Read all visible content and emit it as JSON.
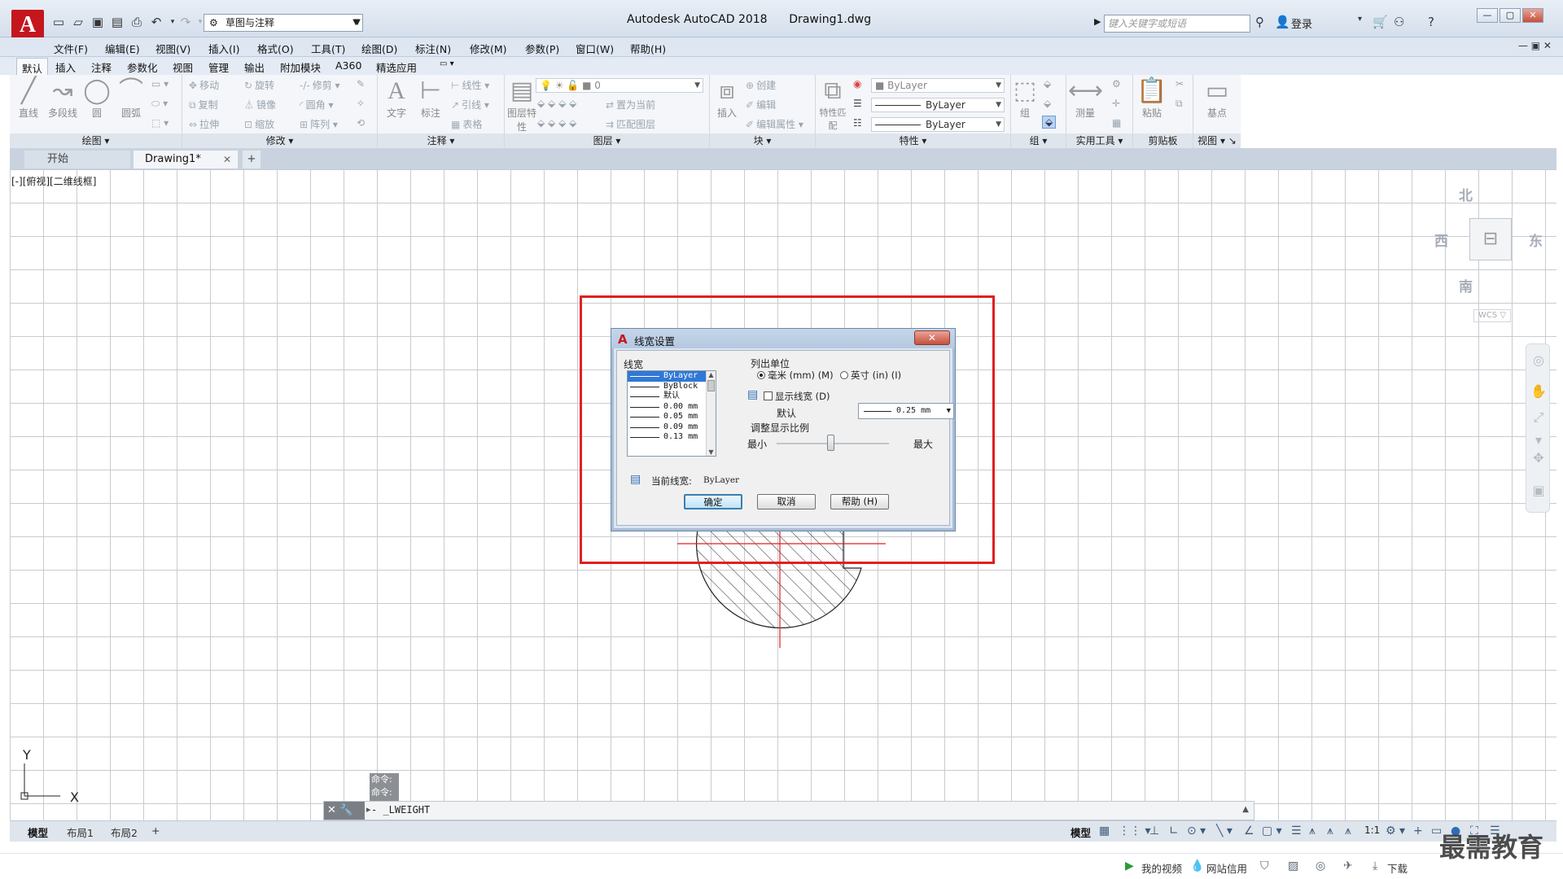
{
  "titlebar": {
    "workspace": "草图与注释",
    "app_name": "Autodesk AutoCAD 2018",
    "document": "Drawing1.dwg",
    "search_placeholder": "键入关键字或短语",
    "login": "登录",
    "app_button": "A"
  },
  "menu": [
    "文件(F)",
    "编辑(E)",
    "视图(V)",
    "插入(I)",
    "格式(O)",
    "工具(T)",
    "绘图(D)",
    "标注(N)",
    "修改(M)",
    "参数(P)",
    "窗口(W)",
    "帮助(H)"
  ],
  "ribbon_tabs": [
    "默认",
    "插入",
    "注释",
    "参数化",
    "视图",
    "管理",
    "输出",
    "附加模块",
    "A360",
    "精选应用"
  ],
  "ribbon": {
    "draw": {
      "title": "绘图",
      "tools": [
        "直线",
        "多段线",
        "圆",
        "圆弧"
      ]
    },
    "modify": {
      "title": "修改",
      "tools": [
        "移动",
        "旋转",
        "修剪",
        "复制",
        "镜像",
        "圆角",
        "拉伸",
        "缩放",
        "阵列"
      ]
    },
    "annotate": {
      "title": "注释",
      "tools": [
        "文字",
        "标注",
        "线性",
        "引线",
        "表格"
      ]
    },
    "layers": {
      "title": "图层",
      "tools": [
        "图层特性",
        "置为当前",
        "匹配图层"
      ],
      "layer_value": "0"
    },
    "block": {
      "title": "块",
      "tools": [
        "插入",
        "创建",
        "编辑",
        "编辑属性"
      ]
    },
    "properties": {
      "title": "特性",
      "tools": [
        "特性匹配"
      ],
      "values": [
        "ByLayer",
        "ByLayer",
        "ByLayer"
      ]
    },
    "groups": {
      "title": "组",
      "tools": [
        "组"
      ]
    },
    "utilities": {
      "title": "实用工具",
      "tools": [
        "测量"
      ]
    },
    "clipboard": {
      "title": "剪贴板",
      "tools": [
        "粘贴"
      ]
    },
    "view": {
      "title": "视图",
      "tools": [
        "基点"
      ]
    }
  },
  "doc_tabs": {
    "start": "开始",
    "drawing": "Drawing1*",
    "add": "+"
  },
  "canvas": {
    "view_label": "[-][俯视][二维线框]",
    "compass": {
      "north": "北",
      "south": "南",
      "west": "西",
      "east": "东"
    },
    "wcs": "WCS ▽",
    "ucs_x": "X",
    "ucs_y": "Y"
  },
  "dialog": {
    "title": "线宽设置",
    "lineweight_label": "线宽",
    "lineweights": [
      "ByLayer",
      "ByBlock",
      "默认",
      "0.00 mm",
      "0.05 mm",
      "0.09 mm",
      "0.13 mm"
    ],
    "selected_lineweight": "ByLayer",
    "units_label": "列出单位",
    "unit_mm": "毫米 (mm) (M)",
    "unit_in": "英寸 (in) (I)",
    "unit_selected": "mm",
    "show_lineweight": "显示线宽 (D)",
    "show_lineweight_checked": false,
    "default_label": "默认",
    "default_value": "0.25 mm",
    "scale_label": "调整显示比例",
    "scale_min": "最小",
    "scale_max": "最大",
    "scale_position": 0.48,
    "current_label": "当前线宽:",
    "current_value": "ByLayer",
    "ok": "确定",
    "cancel": "取消",
    "help": "帮助 (H)"
  },
  "command": {
    "history": [
      "命令:",
      "命令:"
    ],
    "input": "- _LWEIGHT"
  },
  "layout_tabs": [
    "模型",
    "布局1",
    "布局2"
  ],
  "status": {
    "model": "模型",
    "scale": "1:1"
  },
  "footer": {
    "video": "我的视频",
    "credit": "网站信用",
    "download": "下载",
    "watermark": "最需教育"
  },
  "colors": {
    "accent": "#c5161d",
    "selection": "#3178d6",
    "highlight_rect": "#e02020"
  }
}
